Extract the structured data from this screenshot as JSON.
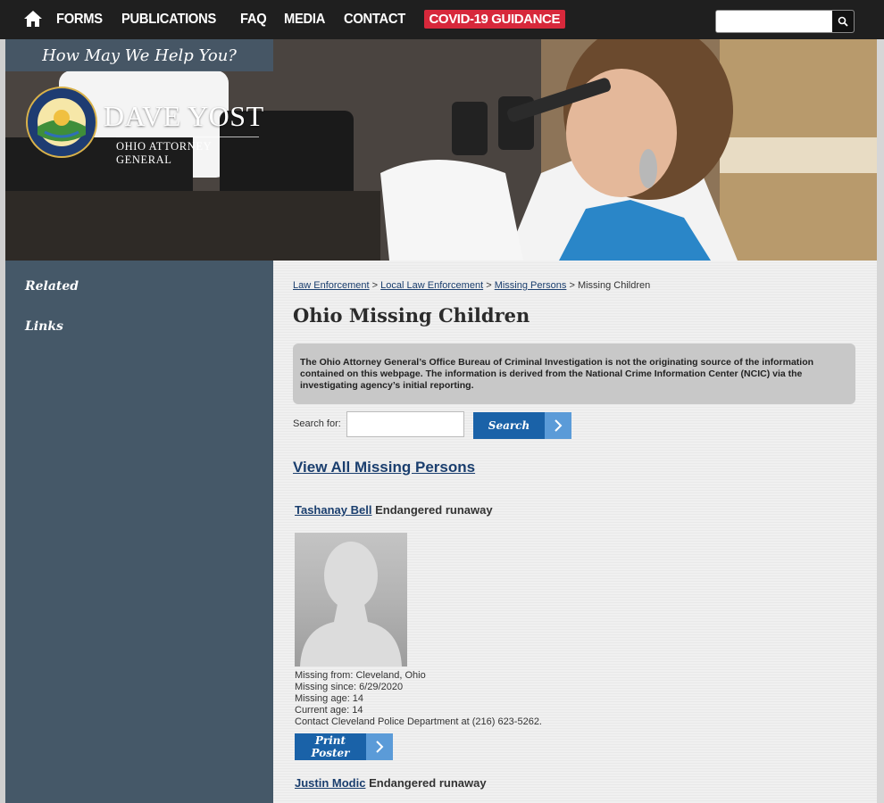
{
  "nav": {
    "home_icon": "home-icon",
    "links": [
      "FORMS",
      "PUBLICATIONS",
      "FAQ",
      "MEDIA",
      "CONTACT"
    ],
    "covid": "COVID-19 GUIDANCE",
    "search_placeholder": "",
    "search_icon": "search-icon",
    "colors": {
      "bar": "#1f1f1f",
      "covid": "#d7283b"
    }
  },
  "hero": {
    "help": "How May We Help You?",
    "brand_name": "DAVE YOST",
    "brand_sub": "OHIO ATTORNEY GENERAL",
    "seal_text": "THE SEAL OF THE ATTORNEY GENERAL OF THE STATE OF OHIO"
  },
  "sidebar": {
    "headings": [
      "Related",
      "Links"
    ]
  },
  "main": {
    "breadcrumb": {
      "links": [
        "Law Enforcement",
        "Local Law Enforcement",
        "Missing Persons"
      ],
      "separator": ">",
      "current": "Missing Children"
    },
    "title": "Ohio Missing Children",
    "notice": "The Ohio Attorney General’s Office Bureau of Criminal Investigation is not the originating source of the information contained on this webpage. The information is derived from the National Crime Information Center (NCIC) via the investigating agency’s initial reporting.",
    "search_label": "Search for:",
    "search_value": "",
    "search_button": "Search",
    "view_all": "View All Missing Persons",
    "persons": [
      {
        "name": "Tashanay Bell",
        "status": "Endangered runaway",
        "missing_from": "Missing from: Cleveland, Ohio",
        "missing_since": "Missing since: 6/29/2020",
        "missing_age": "Missing age: 14",
        "current_age": "Current age: 14",
        "contact": "Contact Cleveland Police Department at (216) 623-5262.",
        "print": "Print Poster"
      },
      {
        "name": "Justin Modic",
        "status": "Endangered runaway"
      }
    ],
    "colors": {
      "accent": "#1a62a8",
      "accent_light": "#5b9bd8",
      "link": "#1a3e6e"
    }
  }
}
